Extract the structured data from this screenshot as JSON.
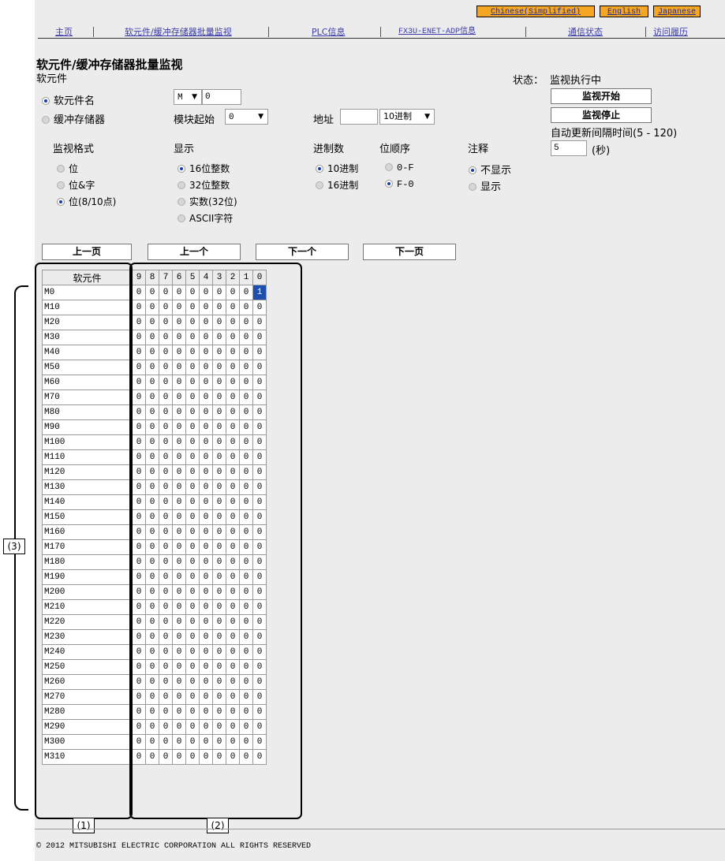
{
  "languages": [
    "Chinese(Simplified)",
    "English",
    "Japanese"
  ],
  "nav": [
    {
      "label": "主页"
    },
    {
      "label": "软元件/缓冲存储器批量监视"
    },
    {
      "label": "PLC信息"
    },
    {
      "label": "FX3U-ENET-ADP信息"
    },
    {
      "label": "通信状态"
    },
    {
      "label": "访问履历"
    }
  ],
  "page_title": "软元件/缓冲存储器批量监视",
  "device_section_label": "软元件",
  "status": {
    "label": "状态：",
    "value": "监视执行中"
  },
  "target": {
    "device_name_label": "软元件名",
    "buffer_memory_label": "缓冲存储器",
    "device_type": "M",
    "device_number": "0",
    "module_start_label": "模块起始",
    "module_start_value": "0",
    "address_label": "地址",
    "address_value": "",
    "address_radix": "10进制"
  },
  "buttons": {
    "start": "监视开始",
    "stop": "监视停止"
  },
  "interval": {
    "label": "自动更新间隔时间(5 - 120)",
    "value": "5",
    "unit": "(秒)"
  },
  "monitor_format": {
    "label": "监视格式",
    "options": [
      "位",
      "位&字",
      "位(8/10点)"
    ],
    "selected": 2
  },
  "display": {
    "label": "显示",
    "options": [
      "16位整数",
      "32位整数",
      "实数(32位)",
      "ASCII字符"
    ],
    "selected": 0
  },
  "radix": {
    "label": "进制数",
    "options": [
      "10进制",
      "16进制"
    ],
    "selected": 0
  },
  "bit_order": {
    "label": "位顺序",
    "options": [
      "0-F",
      "F-0"
    ],
    "selected": 1
  },
  "comment": {
    "label": "注释",
    "options": [
      "不显示",
      "显示"
    ],
    "selected": 0
  },
  "paging": {
    "prev_page": "上一页",
    "prev": "上一个",
    "next": "下一个",
    "next_page": "下一页"
  },
  "table": {
    "device_header": "软元件",
    "bit_headers": [
      "9",
      "8",
      "7",
      "6",
      "5",
      "4",
      "3",
      "2",
      "1",
      "0"
    ],
    "rows": [
      {
        "device": "M0",
        "bits": [
          0,
          0,
          0,
          0,
          0,
          0,
          0,
          0,
          0,
          1
        ]
      },
      {
        "device": "M10",
        "bits": [
          0,
          0,
          0,
          0,
          0,
          0,
          0,
          0,
          0,
          0
        ]
      },
      {
        "device": "M20",
        "bits": [
          0,
          0,
          0,
          0,
          0,
          0,
          0,
          0,
          0,
          0
        ]
      },
      {
        "device": "M30",
        "bits": [
          0,
          0,
          0,
          0,
          0,
          0,
          0,
          0,
          0,
          0
        ]
      },
      {
        "device": "M40",
        "bits": [
          0,
          0,
          0,
          0,
          0,
          0,
          0,
          0,
          0,
          0
        ]
      },
      {
        "device": "M50",
        "bits": [
          0,
          0,
          0,
          0,
          0,
          0,
          0,
          0,
          0,
          0
        ]
      },
      {
        "device": "M60",
        "bits": [
          0,
          0,
          0,
          0,
          0,
          0,
          0,
          0,
          0,
          0
        ]
      },
      {
        "device": "M70",
        "bits": [
          0,
          0,
          0,
          0,
          0,
          0,
          0,
          0,
          0,
          0
        ]
      },
      {
        "device": "M80",
        "bits": [
          0,
          0,
          0,
          0,
          0,
          0,
          0,
          0,
          0,
          0
        ]
      },
      {
        "device": "M90",
        "bits": [
          0,
          0,
          0,
          0,
          0,
          0,
          0,
          0,
          0,
          0
        ]
      },
      {
        "device": "M100",
        "bits": [
          0,
          0,
          0,
          0,
          0,
          0,
          0,
          0,
          0,
          0
        ]
      },
      {
        "device": "M110",
        "bits": [
          0,
          0,
          0,
          0,
          0,
          0,
          0,
          0,
          0,
          0
        ]
      },
      {
        "device": "M120",
        "bits": [
          0,
          0,
          0,
          0,
          0,
          0,
          0,
          0,
          0,
          0
        ]
      },
      {
        "device": "M130",
        "bits": [
          0,
          0,
          0,
          0,
          0,
          0,
          0,
          0,
          0,
          0
        ]
      },
      {
        "device": "M140",
        "bits": [
          0,
          0,
          0,
          0,
          0,
          0,
          0,
          0,
          0,
          0
        ]
      },
      {
        "device": "M150",
        "bits": [
          0,
          0,
          0,
          0,
          0,
          0,
          0,
          0,
          0,
          0
        ]
      },
      {
        "device": "M160",
        "bits": [
          0,
          0,
          0,
          0,
          0,
          0,
          0,
          0,
          0,
          0
        ]
      },
      {
        "device": "M170",
        "bits": [
          0,
          0,
          0,
          0,
          0,
          0,
          0,
          0,
          0,
          0
        ]
      },
      {
        "device": "M180",
        "bits": [
          0,
          0,
          0,
          0,
          0,
          0,
          0,
          0,
          0,
          0
        ]
      },
      {
        "device": "M190",
        "bits": [
          0,
          0,
          0,
          0,
          0,
          0,
          0,
          0,
          0,
          0
        ]
      },
      {
        "device": "M200",
        "bits": [
          0,
          0,
          0,
          0,
          0,
          0,
          0,
          0,
          0,
          0
        ]
      },
      {
        "device": "M210",
        "bits": [
          0,
          0,
          0,
          0,
          0,
          0,
          0,
          0,
          0,
          0
        ]
      },
      {
        "device": "M220",
        "bits": [
          0,
          0,
          0,
          0,
          0,
          0,
          0,
          0,
          0,
          0
        ]
      },
      {
        "device": "M230",
        "bits": [
          0,
          0,
          0,
          0,
          0,
          0,
          0,
          0,
          0,
          0
        ]
      },
      {
        "device": "M240",
        "bits": [
          0,
          0,
          0,
          0,
          0,
          0,
          0,
          0,
          0,
          0
        ]
      },
      {
        "device": "M250",
        "bits": [
          0,
          0,
          0,
          0,
          0,
          0,
          0,
          0,
          0,
          0
        ]
      },
      {
        "device": "M260",
        "bits": [
          0,
          0,
          0,
          0,
          0,
          0,
          0,
          0,
          0,
          0
        ]
      },
      {
        "device": "M270",
        "bits": [
          0,
          0,
          0,
          0,
          0,
          0,
          0,
          0,
          0,
          0
        ]
      },
      {
        "device": "M280",
        "bits": [
          0,
          0,
          0,
          0,
          0,
          0,
          0,
          0,
          0,
          0
        ]
      },
      {
        "device": "M290",
        "bits": [
          0,
          0,
          0,
          0,
          0,
          0,
          0,
          0,
          0,
          0
        ]
      },
      {
        "device": "M300",
        "bits": [
          0,
          0,
          0,
          0,
          0,
          0,
          0,
          0,
          0,
          0
        ]
      },
      {
        "device": "M310",
        "bits": [
          0,
          0,
          0,
          0,
          0,
          0,
          0,
          0,
          0,
          0
        ]
      }
    ]
  },
  "annotations": {
    "c1": "(1)",
    "c2": "(2)",
    "c3": "(3)"
  },
  "footer": "© 2012 MITSUBISHI ELECTRIC CORPORATION ALL RIGHTS RESERVED",
  "colors": {
    "lang_bg": "#f5a623",
    "panel_bg": "#ececec",
    "link": "#3a3aa8",
    "highlight": "#1e4fae"
  }
}
